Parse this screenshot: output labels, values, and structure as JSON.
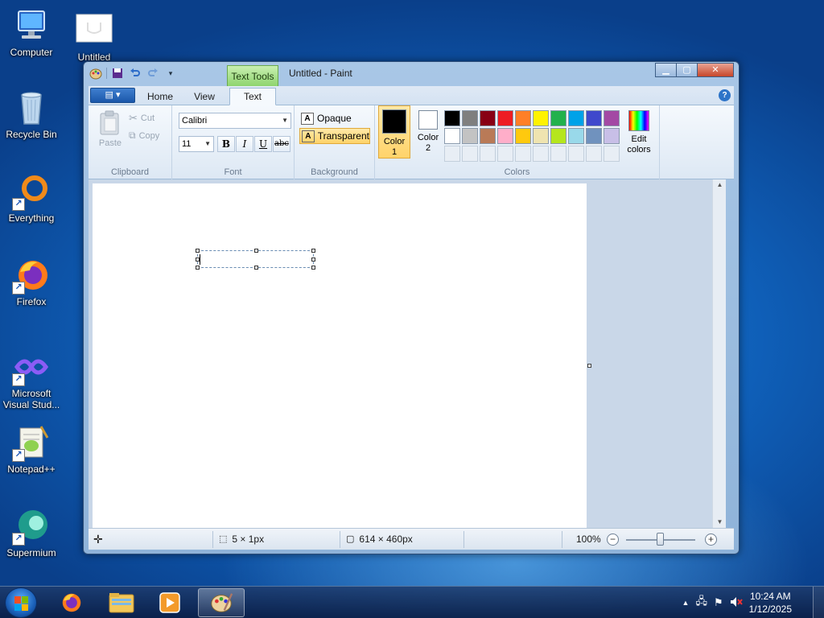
{
  "desktop": {
    "icons": [
      {
        "label": "Computer"
      },
      {
        "label": "Untitled"
      },
      {
        "label": "Recycle Bin"
      },
      {
        "label": "Everything"
      },
      {
        "label": "Firefox"
      },
      {
        "label": "Microsoft Visual Stud..."
      },
      {
        "label": "Notepad++"
      },
      {
        "label": "Supermium"
      }
    ]
  },
  "window": {
    "title": "Untitled - Paint",
    "context_tab": "Text Tools",
    "tabs": [
      "Home",
      "View",
      "Text"
    ],
    "active_tab": "Text"
  },
  "ribbon": {
    "clipboard": {
      "paste": "Paste",
      "cut": "Cut",
      "copy": "Copy",
      "label": "Clipboard"
    },
    "font": {
      "family": "Calibri",
      "size": "11",
      "bold": "B",
      "italic": "I",
      "underline": "U",
      "strike": "abc",
      "label": "Font"
    },
    "background": {
      "opaque": "Opaque",
      "transparent": "Transparent",
      "selected": "Transparent",
      "label": "Background"
    },
    "colors": {
      "color1_line1": "Color",
      "color1_line2": "1",
      "color2_line1": "Color",
      "color2_line2": "2",
      "edit_line1": "Edit",
      "edit_line2": "colors",
      "label": "Colors",
      "color1": "#000000",
      "color2": "#ffffff",
      "palette": [
        "#000000",
        "#7f7f7f",
        "#880015",
        "#ed1c24",
        "#ff7f27",
        "#fff200",
        "#22b14c",
        "#00a2e8",
        "#3f48cc",
        "#a349a4",
        "#ffffff",
        "#c3c3c3",
        "#b97a57",
        "#ffaec9",
        "#ffc90e",
        "#efe4b0",
        "#b5e61d",
        "#99d9ea",
        "#7092be",
        "#c8bfe7"
      ]
    }
  },
  "status": {
    "selection_size": "5 × 1px",
    "canvas_size": "614 × 460px",
    "zoom": "100%"
  },
  "taskbar": {
    "time": "10:24 AM",
    "date": "1/12/2025"
  },
  "colors": {
    "accent": "#1b57aa",
    "context_green": "#8fd46f",
    "selection_yellow": "#ffd36a"
  }
}
